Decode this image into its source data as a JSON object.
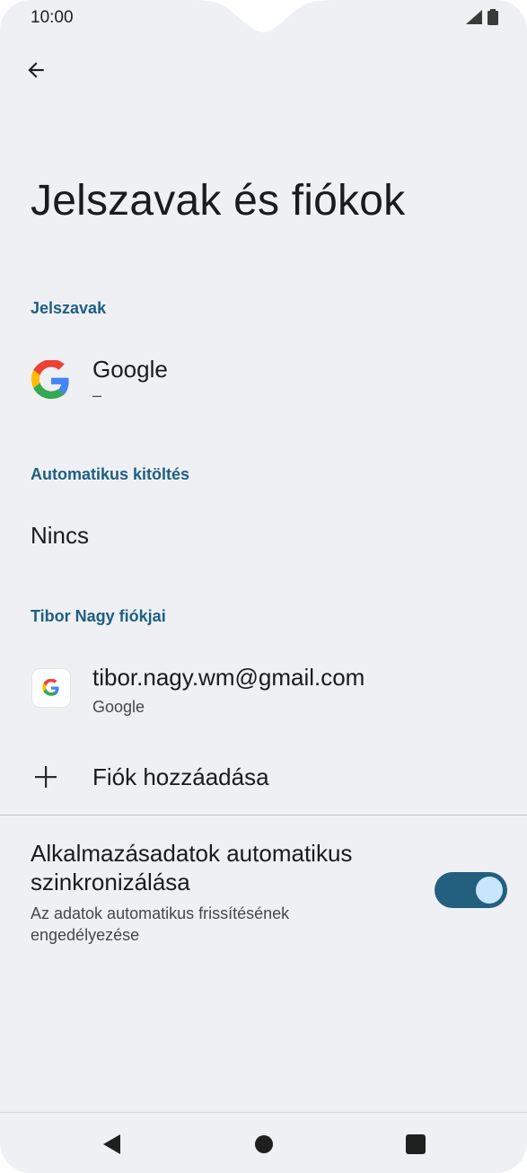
{
  "status_bar": {
    "time": "10:00",
    "icons": [
      "signal-icon",
      "battery-icon"
    ]
  },
  "toolbar": {
    "back_icon": "arrow-left-icon"
  },
  "page": {
    "title": "Jelszavak és fiókok"
  },
  "passwords_section": {
    "header": "Jelszavak",
    "item": {
      "icon": "google-logo-icon",
      "title": "Google",
      "subtitle": "–"
    }
  },
  "autofill_section": {
    "header": "Automatikus kitöltés",
    "value": "Nincs"
  },
  "accounts_section": {
    "header": "Tibor Nagy fiókjai",
    "account": {
      "icon": "google-logo-icon",
      "email": "tibor.nagy.wm@gmail.com",
      "provider": "Google"
    },
    "add_account_label": "Fiók hozzáadása"
  },
  "sync": {
    "title": "Alkalmazásadatok automatikus szinkronizálása",
    "description": "Az adatok automatikus frissítésének engedélyezése",
    "enabled": true
  },
  "nav_bar": {
    "buttons": [
      "back-triangle-icon",
      "home-circle-icon",
      "recents-square-icon"
    ]
  },
  "colors": {
    "background": "#eff0f4",
    "accent_header": "#1d5f83",
    "toggle_track": "#23607f",
    "toggle_knob": "#c8e6fb"
  }
}
